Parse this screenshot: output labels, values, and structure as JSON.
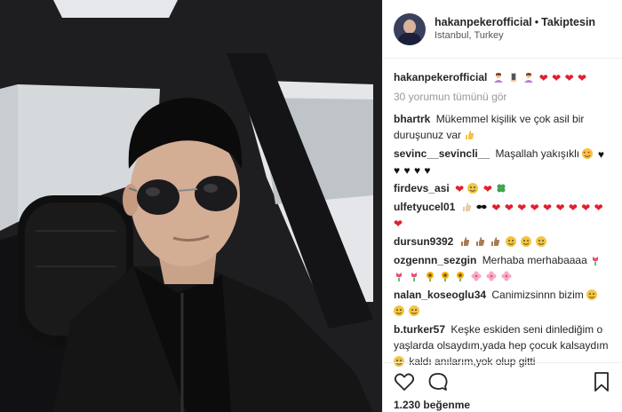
{
  "post": {
    "username": "hakanpekerofficial",
    "separator": "•",
    "follow_label": "Takiptesin",
    "location": "Istanbul, Turkey"
  },
  "caption": {
    "username": "hakanpekerofficial",
    "emoji_names": [
      "woman-gesturing-icon",
      "selfie-hand-icon",
      "woman-gesturing-icon",
      "red-heart-icon",
      "red-heart-icon",
      "red-heart-icon",
      "red-heart-icon"
    ]
  },
  "view_all_comments": "30 yorumun tümünü gör",
  "comments": [
    {
      "username": "bhartrk",
      "text": "Mükemmel kişilik ve çok asil bir duruşunuz var"
    },
    {
      "username": "sevinc__sevincli__",
      "text": "Maşallah yakışıklı"
    },
    {
      "username": "firdevs_asi",
      "text": ""
    },
    {
      "username": "ulfetyucel01",
      "text": ""
    },
    {
      "username": "dursun9392",
      "text": ""
    },
    {
      "username": "ozgennn_sezgin",
      "text": "Merhaba merhabaaaa"
    },
    {
      "username": "nalan_koseoglu34",
      "text": "Canimizsinnn bizim"
    },
    {
      "username": "b.turker57",
      "text_1": "Keşke eskiden seni dinlediğim o yaşlarda olsaydım,yada hep çocuk kalsaydım",
      "text_2": "kaldı anılarım,yok olup gitti"
    }
  ],
  "actions": {
    "like_icon": "heart-outline-icon",
    "comment_icon": "comment-bubble-icon",
    "save_icon": "bookmark-icon",
    "likes_text": "1.230 beğenme"
  },
  "colors": {
    "red_heart": "#e0202e",
    "muted_text": "#999999",
    "border": "#efefef"
  }
}
